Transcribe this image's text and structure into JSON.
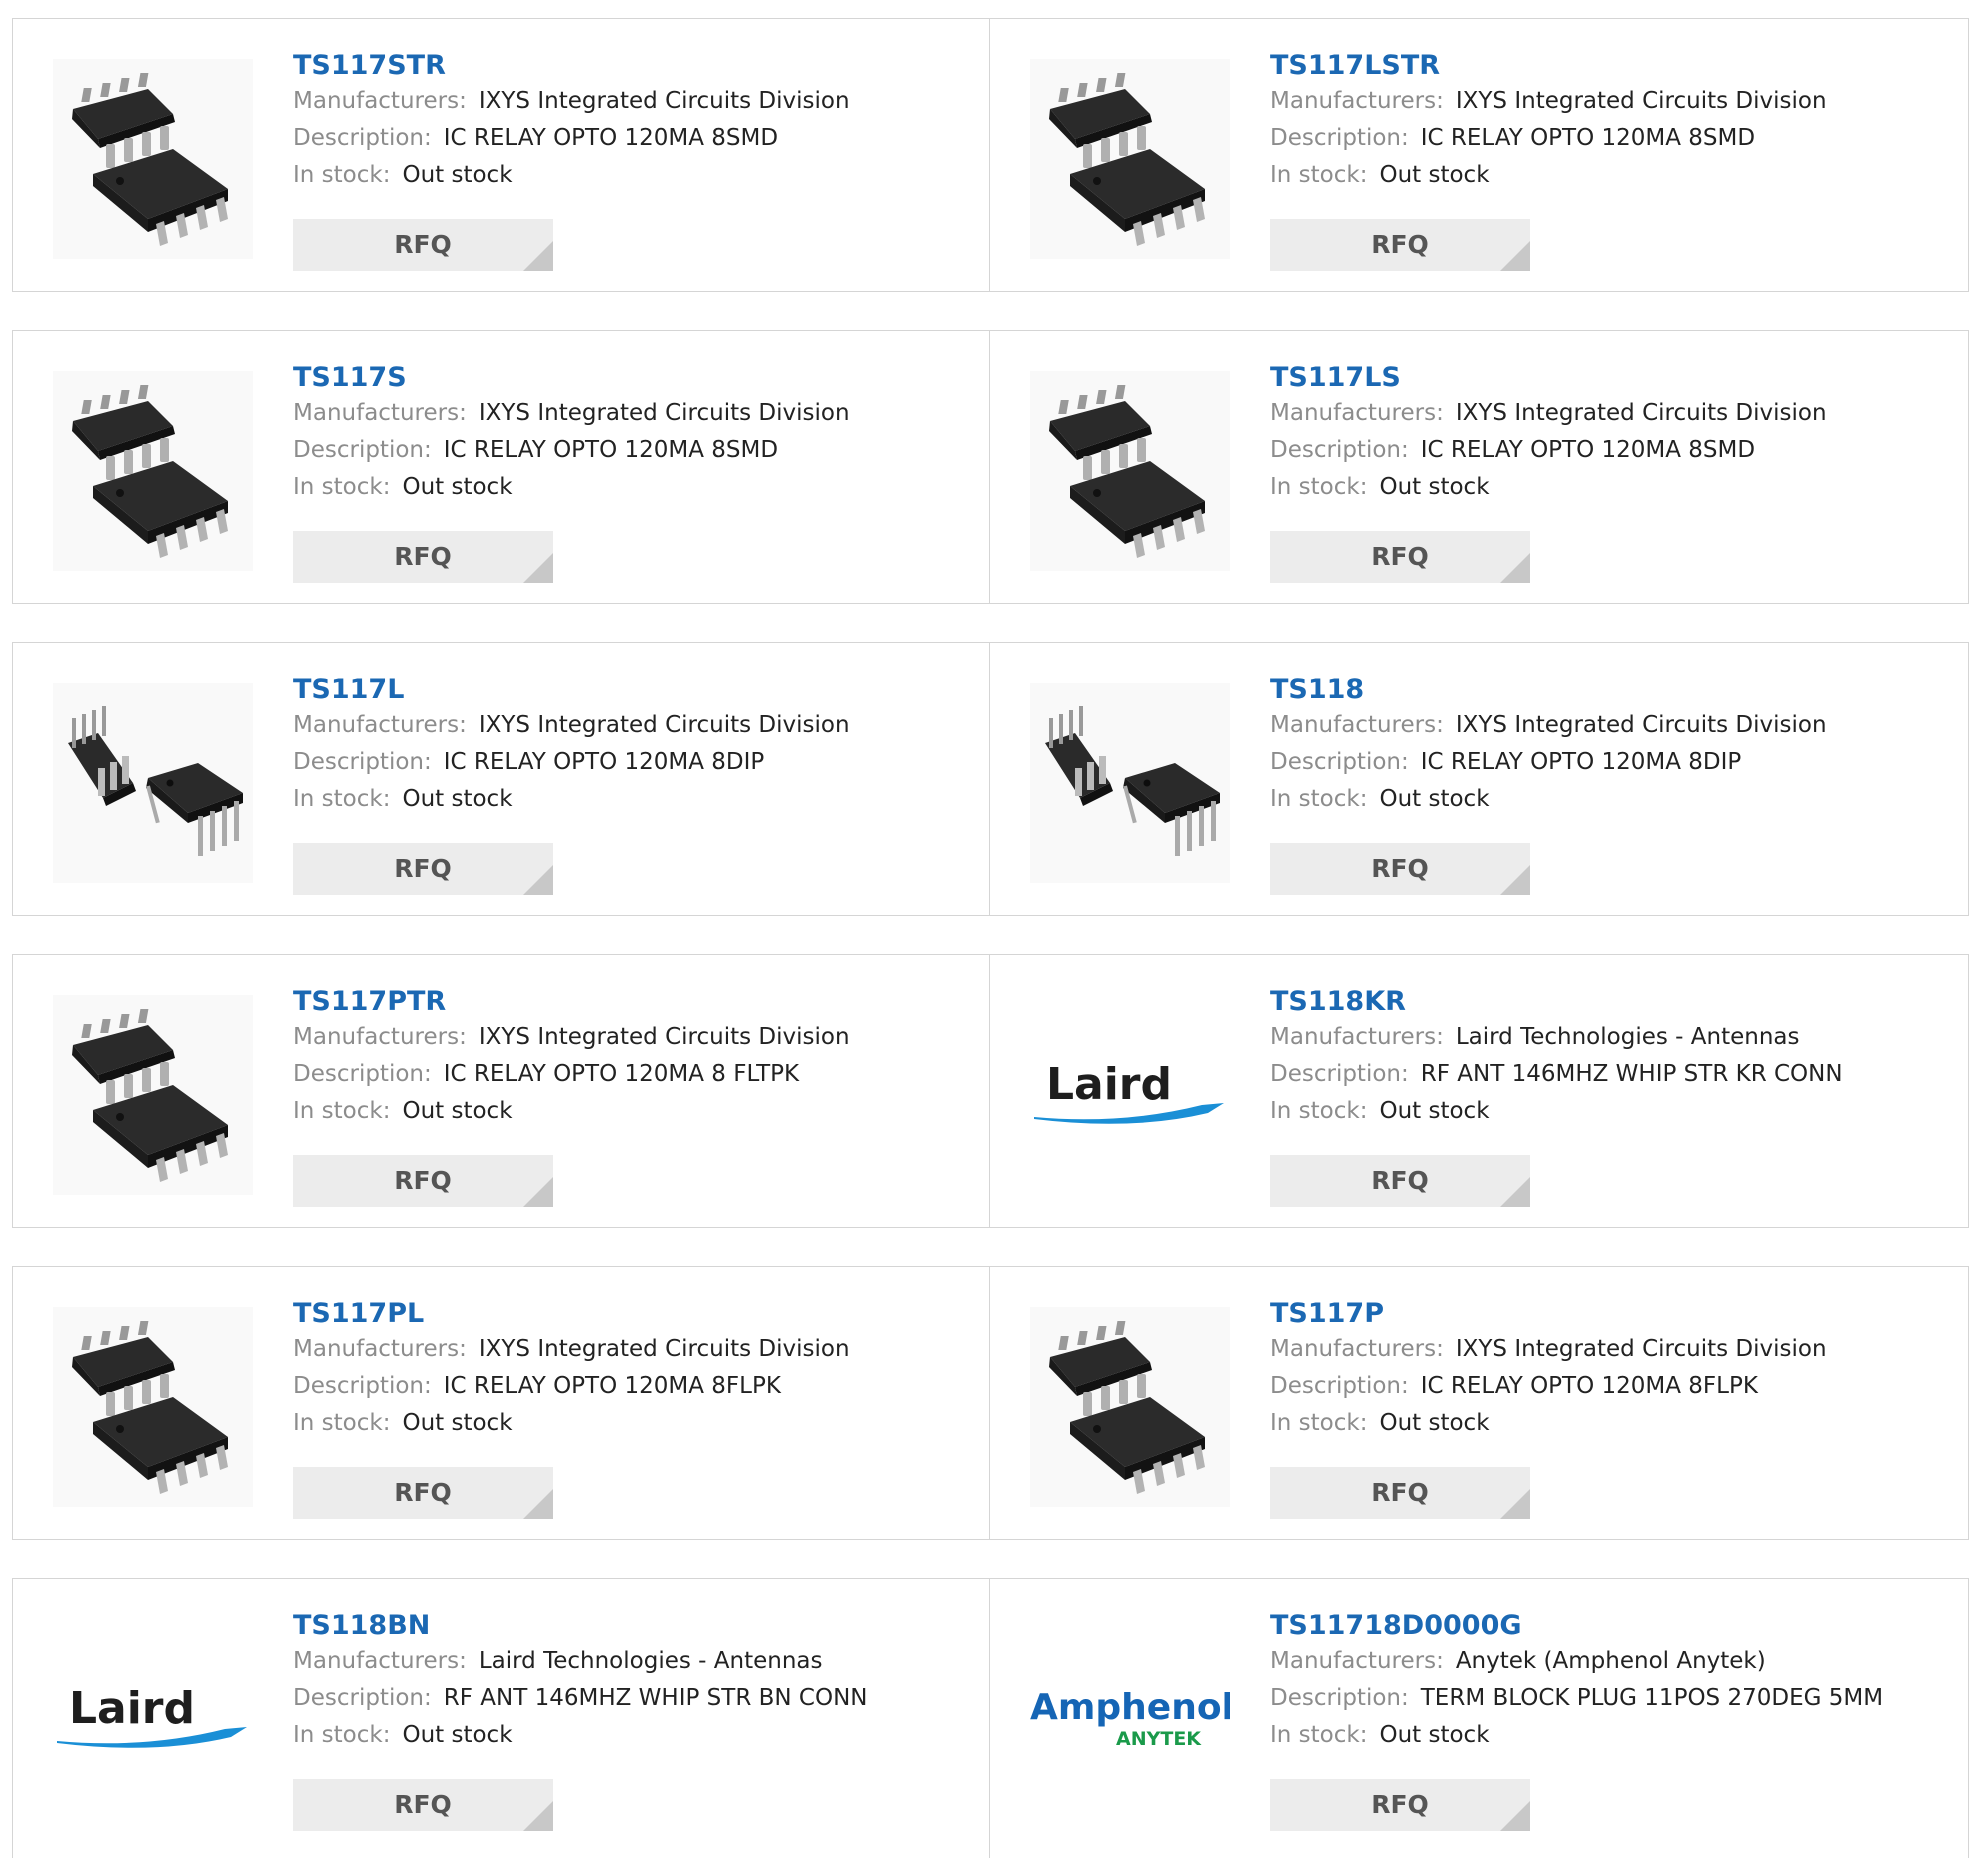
{
  "labels": {
    "manufacturers": "Manufacturers:",
    "description": "Description:",
    "in_stock": "In stock:",
    "rfq": "RFQ"
  },
  "products": [
    {
      "part": "TS117STR",
      "manufacturer": "IXYS Integrated Circuits Division",
      "description": "IC RELAY OPTO 120MA 8SMD",
      "stock": "Out stock",
      "image": "smd-chip-package"
    },
    {
      "part": "TS117LSTR",
      "manufacturer": "IXYS Integrated Circuits Division",
      "description": "IC RELAY OPTO 120MA 8SMD",
      "stock": "Out stock",
      "image": "smd-chip-package"
    },
    {
      "part": "TS117S",
      "manufacturer": "IXYS Integrated Circuits Division",
      "description": "IC RELAY OPTO 120MA 8SMD",
      "stock": "Out stock",
      "image": "smd-chip-package"
    },
    {
      "part": "TS117LS",
      "manufacturer": "IXYS Integrated Circuits Division",
      "description": "IC RELAY OPTO 120MA 8SMD",
      "stock": "Out stock",
      "image": "smd-chip-package"
    },
    {
      "part": "TS117L",
      "manufacturer": "IXYS Integrated Circuits Division",
      "description": "IC RELAY OPTO 120MA 8DIP",
      "stock": "Out stock",
      "image": "dip-chip-package"
    },
    {
      "part": "TS118",
      "manufacturer": "IXYS Integrated Circuits Division",
      "description": "IC RELAY OPTO 120MA 8DIP",
      "stock": "Out stock",
      "image": "dip-chip-package"
    },
    {
      "part": "TS117PTR",
      "manufacturer": "IXYS Integrated Circuits Division",
      "description": "IC RELAY OPTO 120MA 8 FLTPK",
      "stock": "Out stock",
      "image": "smd-chip-package"
    },
    {
      "part": "TS118KR",
      "manufacturer": "Laird Technologies - Antennas",
      "description": "RF ANT 146MHZ WHIP STR KR CONN",
      "stock": "Out stock",
      "image": "laird-logo",
      "logo_text": "Laird"
    },
    {
      "part": "TS117PL",
      "manufacturer": "IXYS Integrated Circuits Division",
      "description": "IC RELAY OPTO 120MA 8FLPK",
      "stock": "Out stock",
      "image": "smd-chip-package"
    },
    {
      "part": "TS117P",
      "manufacturer": "IXYS Integrated Circuits Division",
      "description": "IC RELAY OPTO 120MA 8FLPK",
      "stock": "Out stock",
      "image": "smd-chip-package"
    },
    {
      "part": "TS118BN",
      "manufacturer": "Laird Technologies - Antennas",
      "description": "RF ANT 146MHZ WHIP STR BN CONN",
      "stock": "Out stock",
      "image": "laird-logo",
      "logo_text": "Laird"
    },
    {
      "part": "TS11718D0000G",
      "manufacturer": "Anytek (Amphenol Anytek)",
      "description": "TERM BLOCK PLUG 11POS 270DEG 5MM",
      "stock": "Out stock",
      "image": "amphenol-anytek-logo",
      "logo_text": "Amphenol",
      "logo_subtext": "ANYTEK"
    }
  ],
  "colors": {
    "part_link": "#1b68b3",
    "label_gray": "#8c8c8c",
    "value_text": "#222222",
    "rfq_bg": "#ececec",
    "laird_blue": "#1a8fd6",
    "amphenol_blue": "#1565b5",
    "anytek_green": "#1a9a4a"
  }
}
